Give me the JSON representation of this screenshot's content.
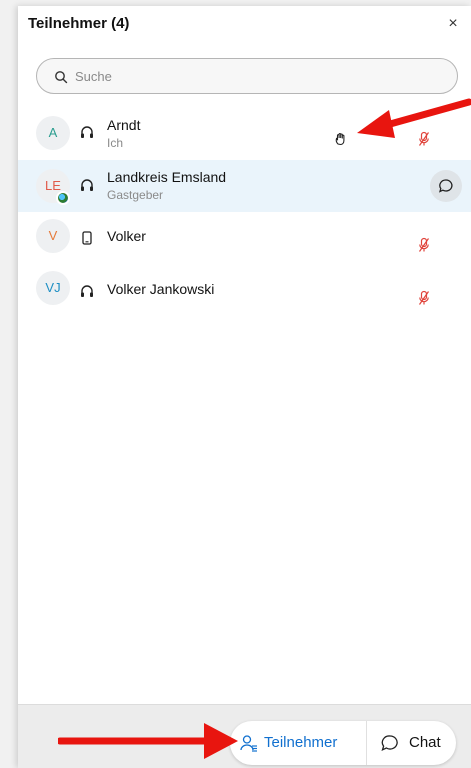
{
  "panel": {
    "title": "Teilnehmer (4)",
    "close_icon": "close-icon",
    "close_glyph": "×"
  },
  "search": {
    "placeholder": "Suche",
    "value": ""
  },
  "participants": [
    {
      "initials": "A",
      "avatar_color": "#2a9d8f",
      "name": "Arndt",
      "role": "Ich",
      "device": "headset-icon",
      "hand_raised": true,
      "muted": true
    },
    {
      "initials": "LE",
      "avatar_color": "#e15a4a",
      "name": "Landkreis Emsland",
      "role": "Gastgeber",
      "device": "headset-icon",
      "selected": true,
      "has_badge": true,
      "chat_button": true
    },
    {
      "initials": "V",
      "avatar_color": "#e57a3a",
      "name": "Volker",
      "role": "",
      "device": "phone-icon",
      "muted": true
    },
    {
      "initials": "VJ",
      "avatar_color": "#1e8fc4",
      "name": "Volker Jankowski",
      "role": "",
      "device": "headset-icon",
      "muted": true
    }
  ],
  "footer": {
    "participants_tab": "Teilnehmer",
    "chat_tab": "Chat"
  },
  "colors": {
    "accent": "#1170cf",
    "muted_red": "#e0443c",
    "annotation_red": "#e8150f"
  }
}
